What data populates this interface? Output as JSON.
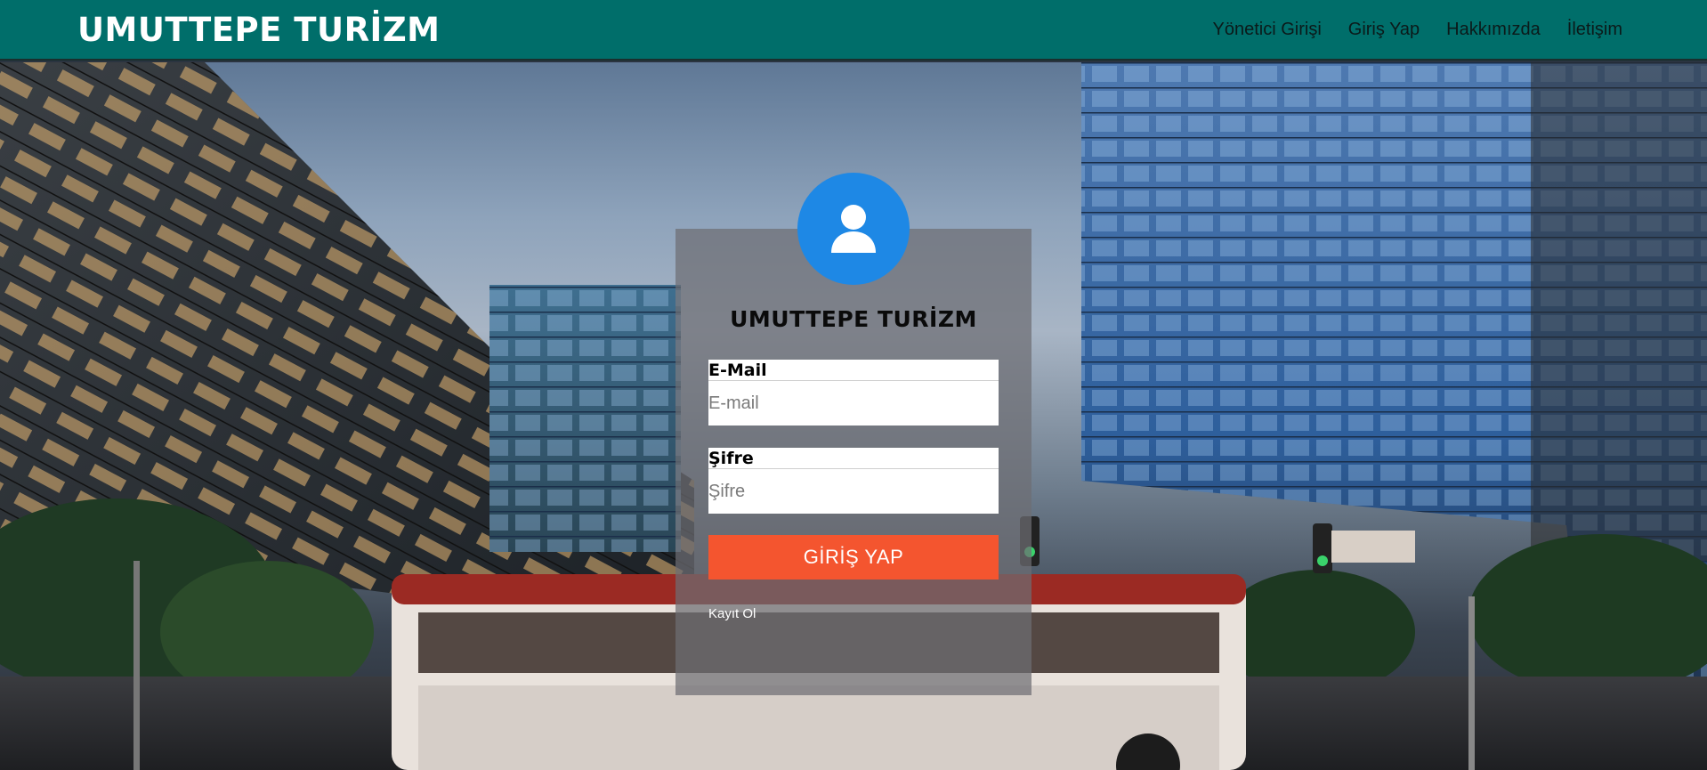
{
  "header": {
    "brand": "UMUTTEPE TURİZM",
    "nav": [
      {
        "label": "Yönetici Girişi"
      },
      {
        "label": "Giriş Yap"
      },
      {
        "label": "Hakkımızda"
      },
      {
        "label": "İletişim"
      }
    ]
  },
  "login": {
    "avatar_icon": "user-icon",
    "title": "UMUTTEPE TURİZM",
    "email_label": "E-Mail",
    "email_placeholder": "E-mail",
    "email_value": "",
    "password_label": "Şifre",
    "password_placeholder": "Şifre",
    "password_value": "",
    "submit_label": "GİRİŞ YAP",
    "register_link": "Kayıt Ol"
  },
  "colors": {
    "header_bg": "#006e6a",
    "avatar_bg": "#1e88e5",
    "button_bg": "#f4552f"
  }
}
